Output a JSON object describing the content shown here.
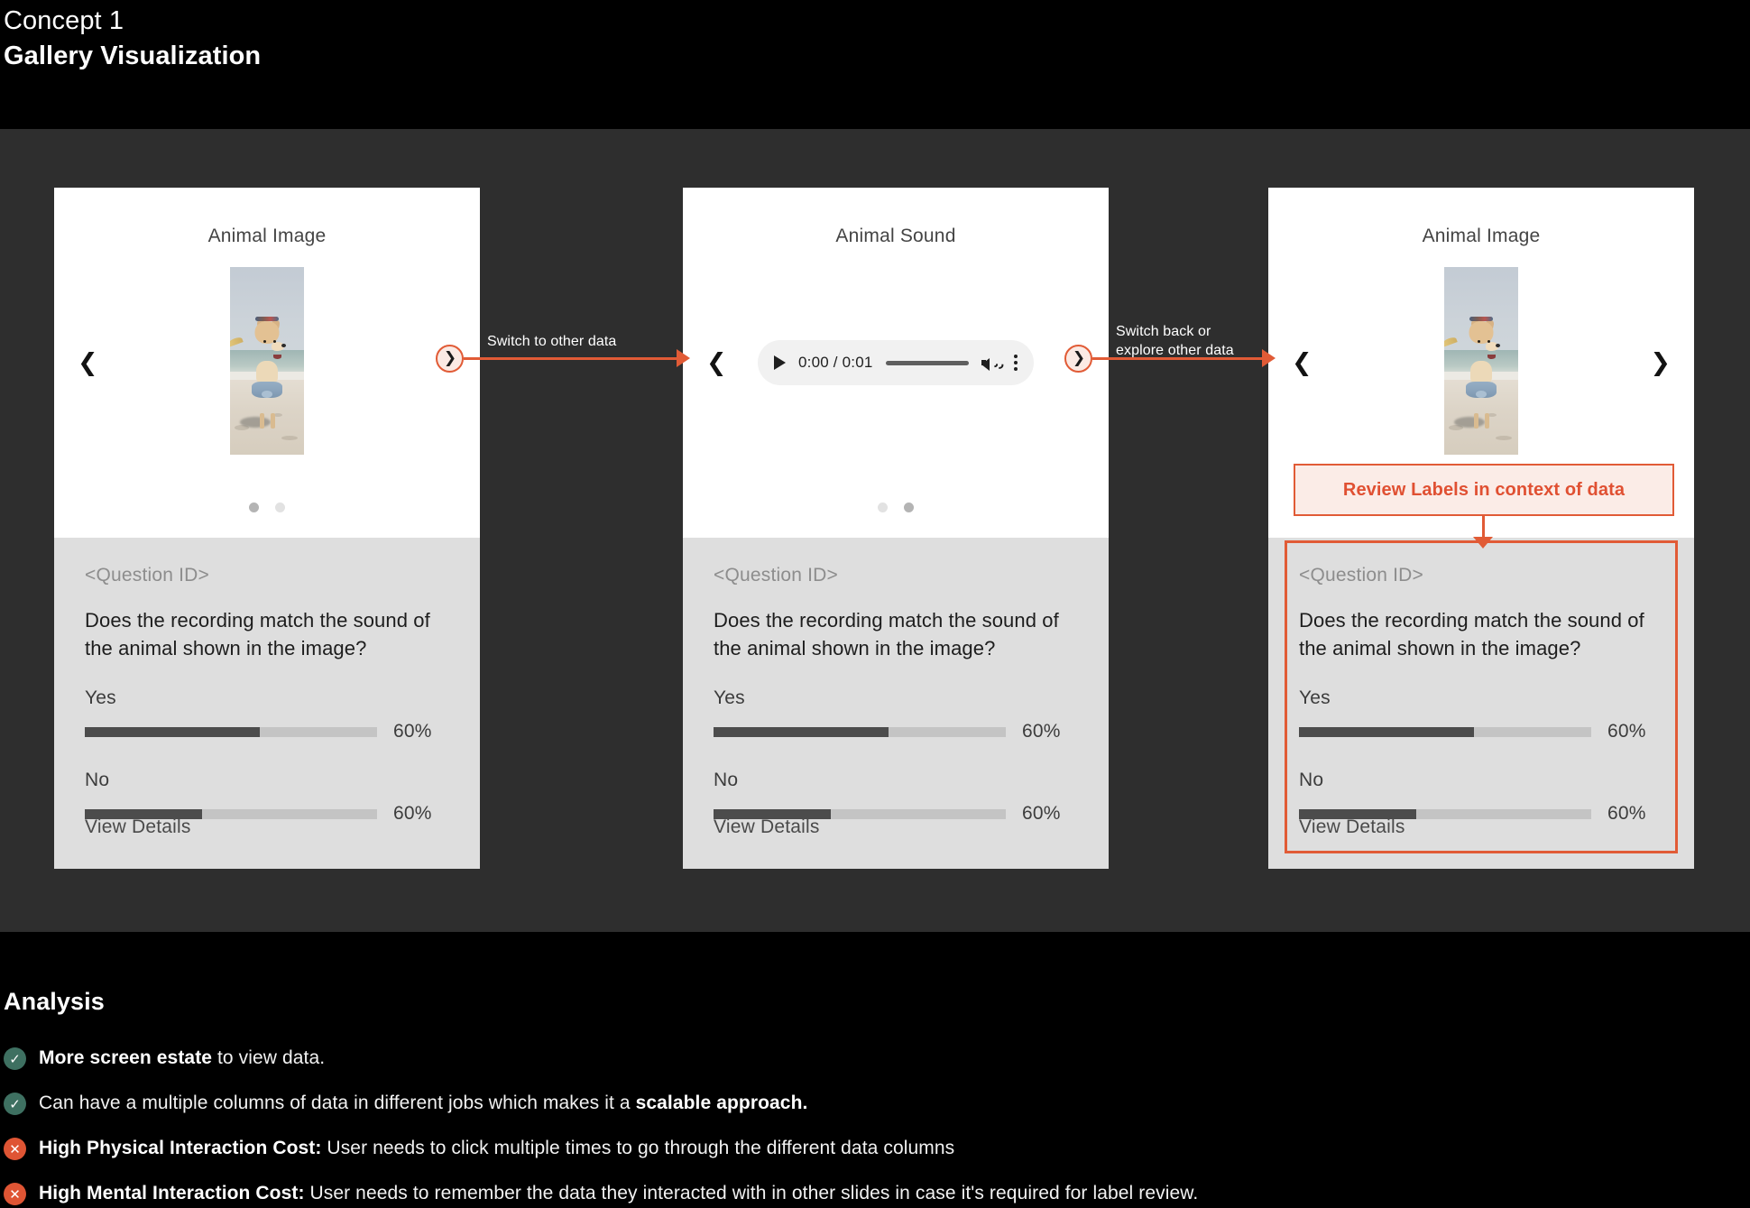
{
  "header": {
    "eyebrow": "Concept 1",
    "title": "Gallery Visualization"
  },
  "colors": {
    "accent": "#E15B36",
    "accent_text": "#E05032",
    "callout_bg": "#FBECE7",
    "stage_bg": "#2e2e2e",
    "card_bg": "#ffffff",
    "panel_bg": "#dedede",
    "bar_track": "#c4c4c4",
    "bar_fill": "#4c4c4c",
    "check_green": "#3E7061",
    "cross_red": "#DF5534"
  },
  "cards": [
    {
      "media_title": "Animal Image",
      "media_type": "image",
      "image_alt": "Shiba Inu dog sitting on beach sand wearing a denim shirt and patterned hat",
      "nav_left_icon": "chevron-left-icon",
      "nav_left_visible": true,
      "nav_right_visible": false,
      "dots": [
        {
          "active": true
        },
        {
          "active": false
        }
      ],
      "question_id": "<Question ID>",
      "question": "Does the recording match the sound of the animal shown in the image?",
      "answers": [
        {
          "label": "Yes",
          "percent_label": "60%",
          "fill": 60
        },
        {
          "label": "No",
          "percent_label": "60%",
          "fill": 40
        }
      ],
      "view_details": "View Details",
      "highlighted": false
    },
    {
      "media_title": "Animal Sound",
      "media_type": "audio",
      "audio": {
        "play_icon": "play-icon",
        "time": "0:00 / 0:01",
        "volume_icon": "volume-icon",
        "menu_icon": "more-vertical-icon"
      },
      "nav_left_icon": "chevron-left-icon",
      "nav_left_visible": true,
      "nav_right_visible": false,
      "dots": [
        {
          "active": false
        },
        {
          "active": true
        }
      ],
      "question_id": "<Question ID>",
      "question": "Does the recording match the sound of the animal shown in the image?",
      "answers": [
        {
          "label": "Yes",
          "percent_label": "60%",
          "fill": 60
        },
        {
          "label": "No",
          "percent_label": "60%",
          "fill": 40
        }
      ],
      "view_details": "View Details",
      "highlighted": false
    },
    {
      "media_title": "Animal Image",
      "media_type": "image",
      "image_alt": "Shiba Inu dog sitting on beach sand wearing a denim shirt and patterned hat",
      "nav_left_icon": "chevron-left-icon",
      "nav_left_visible": true,
      "nav_right_visible": true,
      "dots": [],
      "question_id": "<Question ID>",
      "question": "Does the recording match the sound of the animal shown in the image?",
      "answers": [
        {
          "label": "Yes",
          "percent_label": "60%",
          "fill": 60
        },
        {
          "label": "No",
          "percent_label": "60%",
          "fill": 40
        }
      ],
      "view_details": "View Details",
      "highlighted": true
    }
  ],
  "flows": [
    {
      "label": "Switch to other data",
      "badge_icon": "chevron-right-icon"
    },
    {
      "label": "Switch back or\nexplore other data",
      "badge_icon": "chevron-right-icon"
    }
  ],
  "callout": {
    "text": "Review Labels in context of data"
  },
  "analysis": {
    "title": "Analysis",
    "items": [
      {
        "icon": "check-circle-icon",
        "type": "ok",
        "glyph": "✓",
        "bold": "More screen estate",
        "rest": " to view data."
      },
      {
        "icon": "check-circle-icon",
        "type": "ok",
        "glyph": "✓",
        "bold_trailing": true,
        "pre": "Can have a multiple columns of data in different jobs which makes it a ",
        "bold": "scalable approach.",
        "rest": ""
      },
      {
        "icon": "x-circle-icon",
        "type": "bad",
        "glyph": "✕",
        "bold": "High Physical Interaction Cost:",
        "rest": " User needs to click multiple times to go through the different data columns"
      },
      {
        "icon": "x-circle-icon",
        "type": "bad",
        "glyph": "✕",
        "bold": "High Mental Interaction Cost:",
        "rest": " User needs to remember the data they interacted with in other slides in case it's required for label review."
      }
    ]
  }
}
